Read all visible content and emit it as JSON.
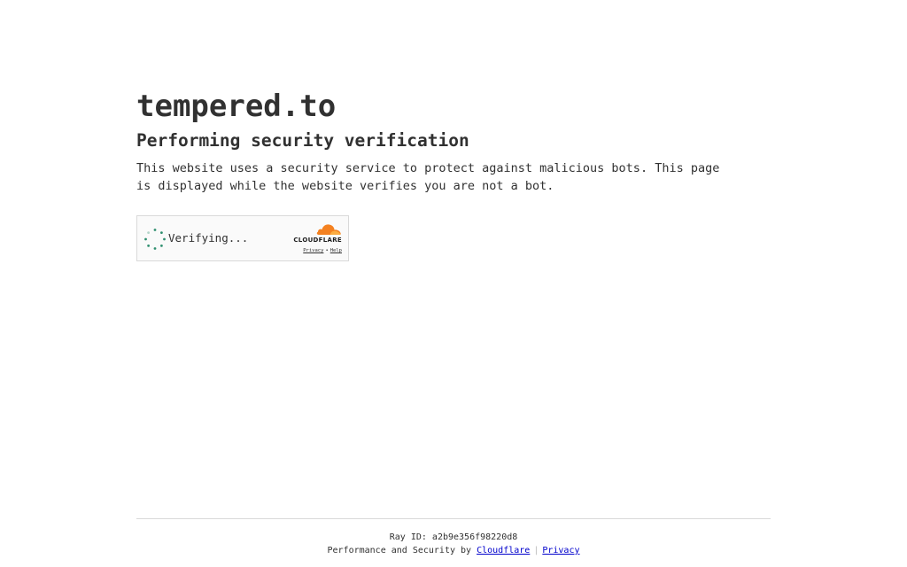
{
  "site": {
    "title": "tempered.to"
  },
  "verification": {
    "heading": "Performing security verification",
    "description": "This website uses a security service to protect against malicious bots. This page is displayed while the website verifies you are not a bot."
  },
  "widget": {
    "status": "Verifying...",
    "brand": "CLOUDFLARE",
    "privacy_label": "Privacy",
    "separator": "•",
    "help_label": "Help",
    "spinner_color": "#2f8f6f",
    "cloud_color": "#f48120"
  },
  "footer": {
    "ray_prefix": "Ray ID:",
    "ray_id": "a2b9e356f98220d8",
    "perf_text": "Performance and Security by",
    "cloudflare_link": "Cloudflare",
    "divider": "|",
    "privacy_link": "Privacy"
  }
}
